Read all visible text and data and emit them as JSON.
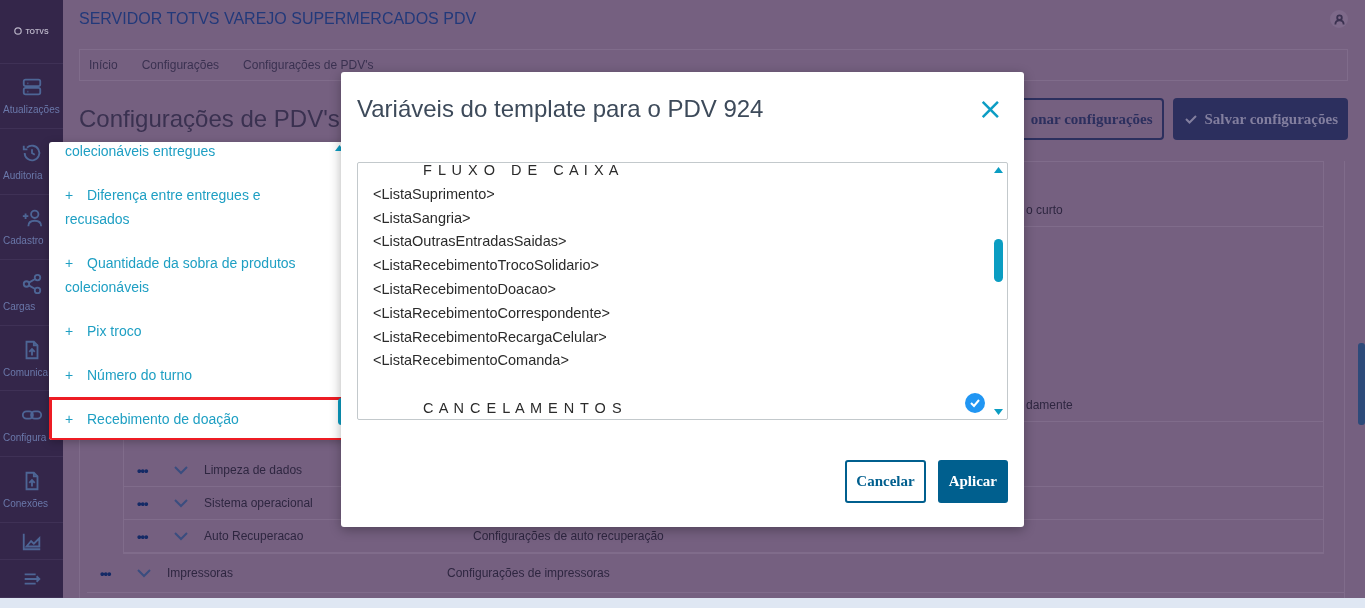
{
  "sidebar": {
    "logo": "TOTVS",
    "items": [
      {
        "kind": "server",
        "label": "Atualizações"
      },
      {
        "kind": "history",
        "label": "Auditoria"
      },
      {
        "kind": "user-plus",
        "label": "Cadastro"
      },
      {
        "kind": "share",
        "label": "Cargas"
      },
      {
        "kind": "upload",
        "label": "Comunica"
      },
      {
        "kind": "link",
        "label": "Configura"
      },
      {
        "kind": "upload",
        "label": "Conexões"
      },
      {
        "kind": "chart"
      },
      {
        "kind": "collapse"
      }
    ]
  },
  "header": {
    "title": "SERVIDOR TOTVS VAREJO SUPERMERCADOS PDV"
  },
  "breadcrumb": [
    "Início",
    "Configurações",
    "Configurações de PDV's"
  ],
  "page_title": "Configurações de PDV's",
  "actions": [
    {
      "kind": "outline",
      "label": "onar configurações"
    },
    {
      "kind": "primary",
      "label": "Salvar configurações"
    }
  ],
  "table": {
    "rows": [
      {
        "children": [
          {
            "description": "o curto"
          },
          {
            "description": "damente"
          },
          {
            "menu": "•••",
            "name": "Limpeza de dados"
          },
          {
            "menu": "•••",
            "name": "Sistema operacional"
          },
          {
            "menu": "•••",
            "name": "Auto Recuperacao",
            "description": "Configurações de auto recuperação"
          }
        ]
      },
      {
        "menu": "•••",
        "name": "Impressoras",
        "description": "Configurações de impressoras"
      }
    ]
  },
  "variables_popup": {
    "items": [
      {
        "label": "colecionáveis entregues",
        "marked": false
      },
      {
        "plus": "+",
        "label": "Diferença entre entregues e recusados",
        "marked": false
      },
      {
        "plus": "+",
        "label": "Quantidade da sobra de produtos colecionáveis",
        "marked": false
      },
      {
        "plus": "+",
        "label": "Pix troco",
        "marked": false
      },
      {
        "plus": "+",
        "label": "Número do turno",
        "marked": false
      },
      {
        "plus": "+",
        "label": "Recebimento de doação",
        "marked": true
      }
    ]
  },
  "modal": {
    "title": "Variáveis do template para o PDV 924",
    "close": "×",
    "template_lines": [
      {
        "kind": "heading",
        "text": "F L U X O   D E   C A I X A"
      },
      {
        "kind": "tag",
        "text": "<ListaSuprimento>"
      },
      {
        "kind": "tag",
        "text": "<ListaSangria>"
      },
      {
        "kind": "tag",
        "text": "<ListaOutrasEntradasSaidas>"
      },
      {
        "kind": "tag",
        "text": "<ListaRecebimentoTrocoSolidario>"
      },
      {
        "kind": "tag",
        "text": "<ListaRecebimentoDoacao>"
      },
      {
        "kind": "tag",
        "text": "<ListaRecebimentoCorrespondente>"
      },
      {
        "kind": "tag",
        "text": "<ListaRecebimentoRecargaCelular>"
      },
      {
        "kind": "tag",
        "text": "<ListaRecebimentoComanda>"
      },
      {
        "kind": "heading",
        "text": "C A N C E L A M E N T O S"
      }
    ],
    "buttons": [
      {
        "kind": "outline",
        "label": "Cancelar"
      },
      {
        "kind": "primary",
        "label": "Aplicar"
      }
    ]
  }
}
